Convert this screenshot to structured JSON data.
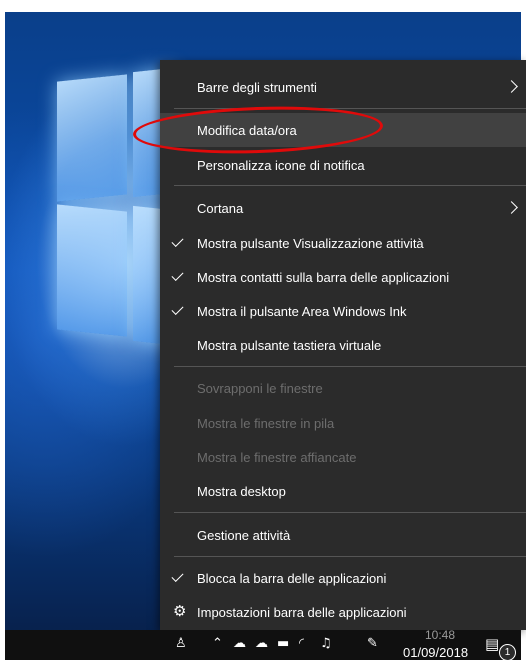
{
  "context_menu": {
    "items": [
      {
        "label": "Barre degli strumenti",
        "submenu": true
      },
      {
        "label": "Modifica data/ora",
        "highlighted": true
      },
      {
        "label": "Personalizza icone di notifica"
      },
      {
        "label": "Cortana",
        "submenu": true
      },
      {
        "label": "Mostra pulsante Visualizzazione attività",
        "checked": true
      },
      {
        "label": "Mostra contatti sulla barra delle applicazioni",
        "checked": true
      },
      {
        "label": "Mostra il pulsante Area Windows Ink",
        "checked": true
      },
      {
        "label": "Mostra pulsante tastiera virtuale"
      },
      {
        "label": "Sovrapponi le finestre",
        "disabled": true
      },
      {
        "label": "Mostra le finestre in pila",
        "disabled": true
      },
      {
        "label": "Mostra le finestre affiancate",
        "disabled": true
      },
      {
        "label": "Mostra desktop"
      },
      {
        "label": "Gestione attività"
      },
      {
        "label": "Blocca la barra delle applicazioni",
        "checked": true
      },
      {
        "label": "Impostazioni barra delle applicazioni",
        "icon": "gear-icon"
      }
    ]
  },
  "taskbar": {
    "date": "01/09/2018",
    "time": "10:48",
    "notification_count": "1",
    "tray_icons": [
      "people-icon",
      "chevron-up-icon",
      "onedrive-icon",
      "cloud-upload-icon",
      "battery-icon",
      "wifi-icon",
      "volume-icon",
      "pen-icon",
      "notification-center-icon"
    ]
  },
  "colors": {
    "menu_bg": "#2b2b2b",
    "menu_hover": "#414141",
    "disabled_text": "#6d6d6d",
    "annotation": "#e00a0a",
    "taskbar_bg": "#101010"
  }
}
